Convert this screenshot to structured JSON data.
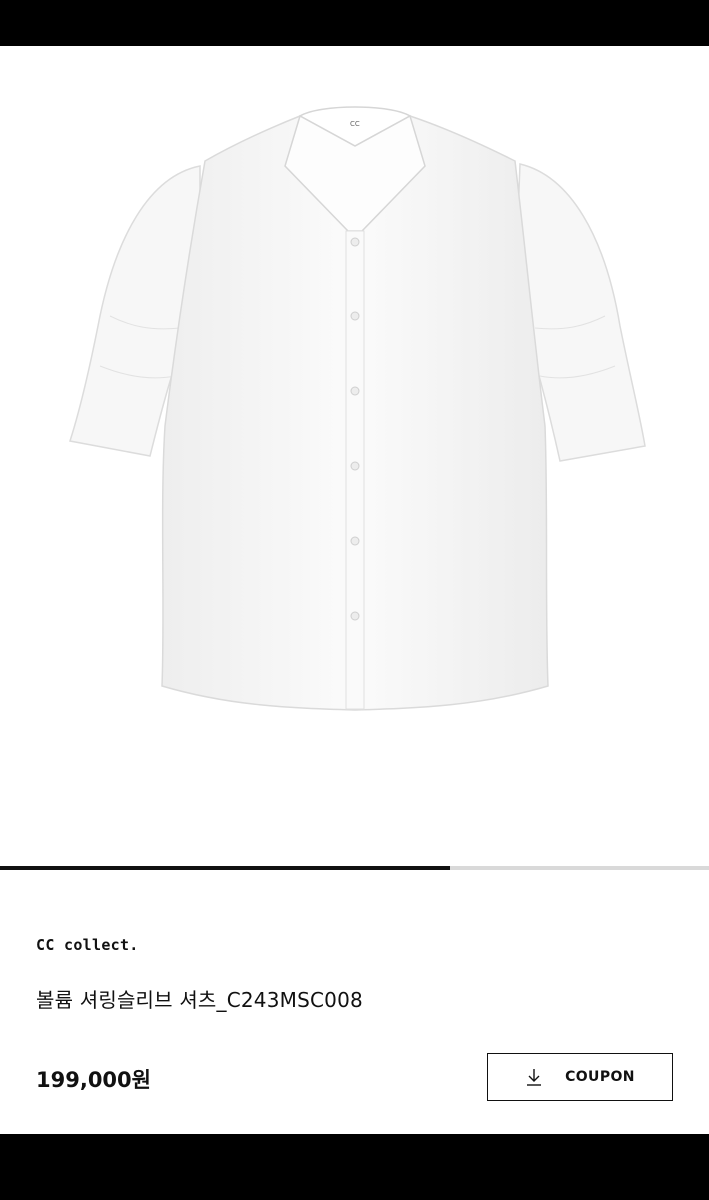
{
  "product": {
    "image_alt": "white shirt product photo",
    "collar_label": "CC",
    "brand": "CC collect.",
    "name": "볼륨 셔링슬리브 셔츠_C243MSC008",
    "price": "199,000원"
  },
  "gallery": {
    "progress": 0.635
  },
  "actions": {
    "coupon_label": "COUPON",
    "coupon_icon": "download-arrow-icon"
  }
}
